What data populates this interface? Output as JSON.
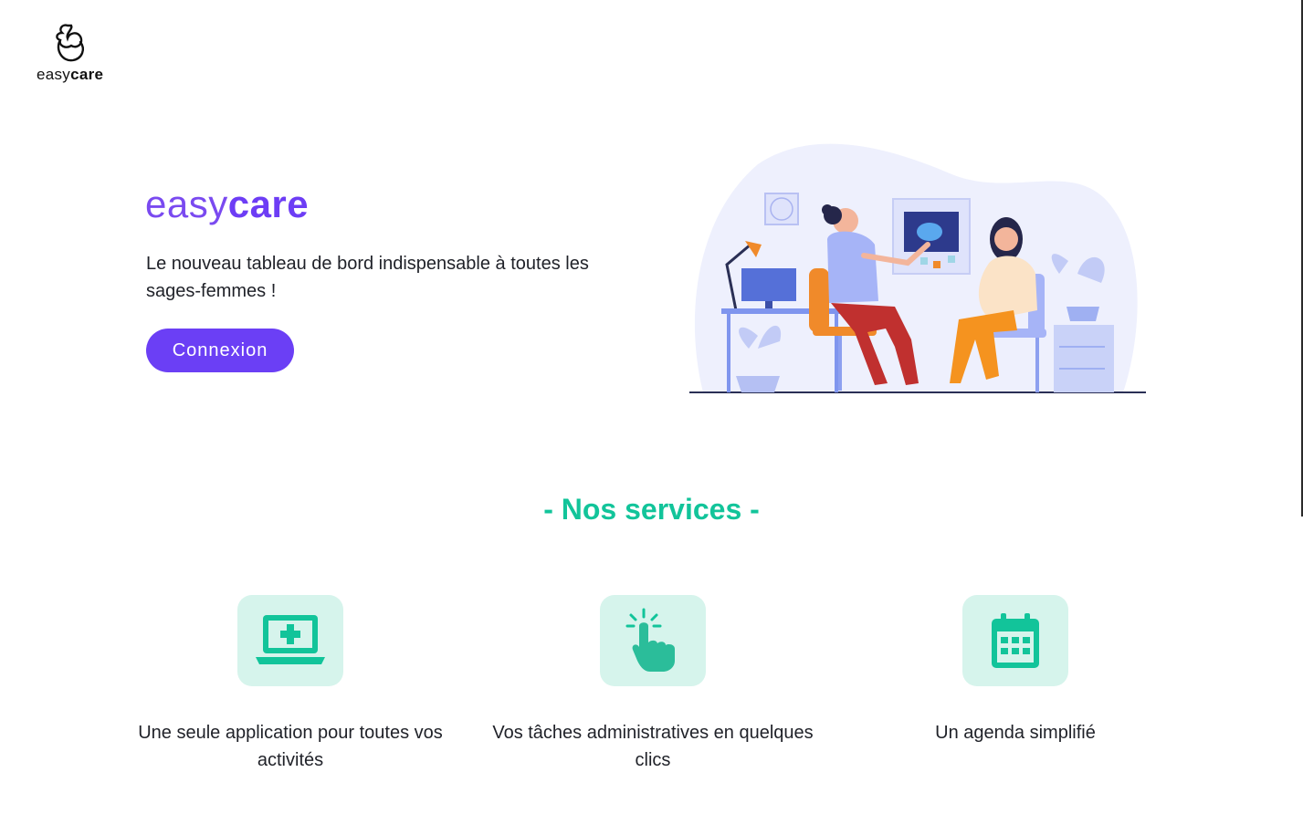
{
  "header": {
    "logo": {
      "light": "easy",
      "bold": "care"
    }
  },
  "hero": {
    "brand": {
      "light": "easy",
      "bold": "care"
    },
    "tagline": "Le nouveau tableau de bord indispensable à toutes les sages-femmes !",
    "cta_label": "Connexion",
    "illustration": "midwife-consultation-illustration"
  },
  "services": {
    "title": "- Nos services -",
    "items": [
      {
        "icon": "medical-laptop-icon",
        "label": "Une seule application pour toutes vos activités"
      },
      {
        "icon": "tap-hand-icon",
        "label": "Vos tâches administratives en quelques clics"
      },
      {
        "icon": "calendar-icon",
        "label": "Un agenda simplifié"
      }
    ]
  },
  "colors": {
    "brand_purple": "#6b3ff5",
    "accent_teal": "#12c49a",
    "icon_tile_bg": "#d6f4ec",
    "text": "#1f2128"
  }
}
